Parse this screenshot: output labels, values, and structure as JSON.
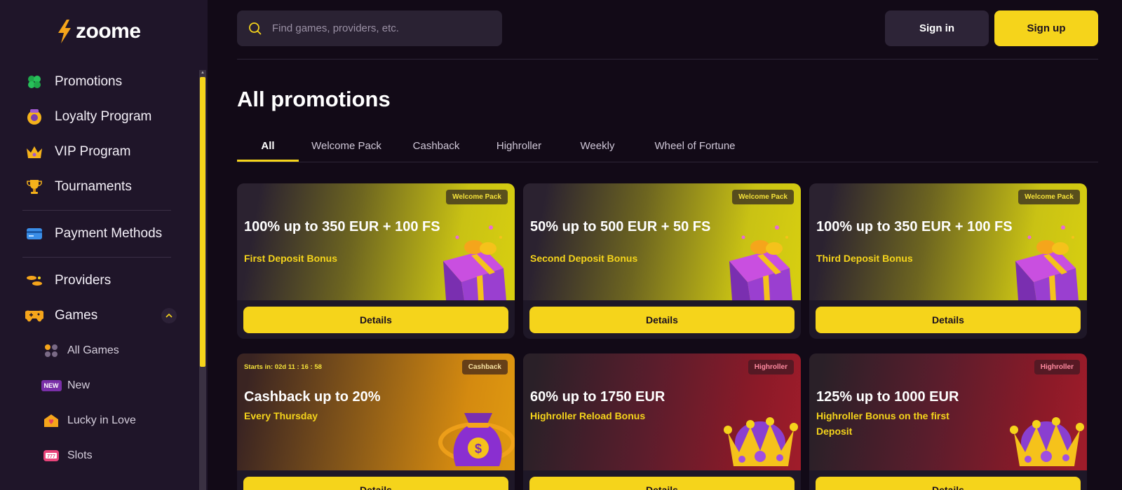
{
  "brand": {
    "name": "zoome"
  },
  "sidebar": {
    "items": [
      {
        "label": "Promotions",
        "icon": "clover-icon"
      },
      {
        "label": "Loyalty Program",
        "icon": "loyalty-icon"
      },
      {
        "label": "VIP Program",
        "icon": "crown-icon"
      },
      {
        "label": "Tournaments",
        "icon": "trophy-icon"
      },
      {
        "label": "Payment Methods",
        "icon": "card-icon"
      },
      {
        "label": "Providers",
        "icon": "providers-icon"
      },
      {
        "label": "Games",
        "icon": "gamepad-icon"
      }
    ],
    "games_sub": [
      {
        "label": "All Games",
        "icon": "grid-dots-icon"
      },
      {
        "label": "New",
        "badge": "NEW"
      },
      {
        "label": "Lucky in Love",
        "icon": "love-envelope-icon"
      },
      {
        "label": "Slots",
        "icon": "slot-777-icon"
      }
    ]
  },
  "header": {
    "search_placeholder": "Find games, providers, etc.",
    "signin_label": "Sign in",
    "signup_label": "Sign up"
  },
  "page": {
    "title": "All promotions",
    "tabs": [
      "All",
      "Welcome Pack",
      "Cashback",
      "Highroller",
      "Weekly",
      "Wheel of Fortune"
    ],
    "active_tab": "All"
  },
  "promotions": [
    {
      "badge": "Welcome Pack",
      "title": "100% up to 350 EUR + 100 FS",
      "subtitle": "First Deposit Bonus",
      "button": "Details",
      "theme": "yellow",
      "art": "gift-box"
    },
    {
      "badge": "Welcome Pack",
      "title": "50% up to 500 EUR + 50 FS",
      "subtitle": "Second Deposit Bonus",
      "button": "Details",
      "theme": "yellow",
      "art": "gift-box"
    },
    {
      "badge": "Welcome Pack",
      "title": "100% up to 350 EUR + 100 FS",
      "subtitle": "Third Deposit Bonus",
      "button": "Details",
      "theme": "yellow",
      "art": "gift-box"
    },
    {
      "badge": "Cashback",
      "timer": "Starts in: 02d 11 : 16 : 58",
      "title": "Cashback up to 20%",
      "subtitle": "Every Thursday",
      "button": "Details",
      "theme": "orange",
      "art": "money-bag"
    },
    {
      "badge": "Highroller",
      "title": "60% up to 1750 EUR",
      "subtitle": "Highroller Reload Bonus",
      "button": "Details",
      "theme": "red",
      "art": "crown"
    },
    {
      "badge": "Highroller",
      "title": "125% up to 1000 EUR",
      "subtitle": "Highroller Bonus on the first Deposit",
      "button": "Details",
      "theme": "red",
      "art": "crown"
    }
  ],
  "colors": {
    "accent": "#f5d41b",
    "sidebar_bg": "#1f1529",
    "page_bg": "#120a17"
  }
}
